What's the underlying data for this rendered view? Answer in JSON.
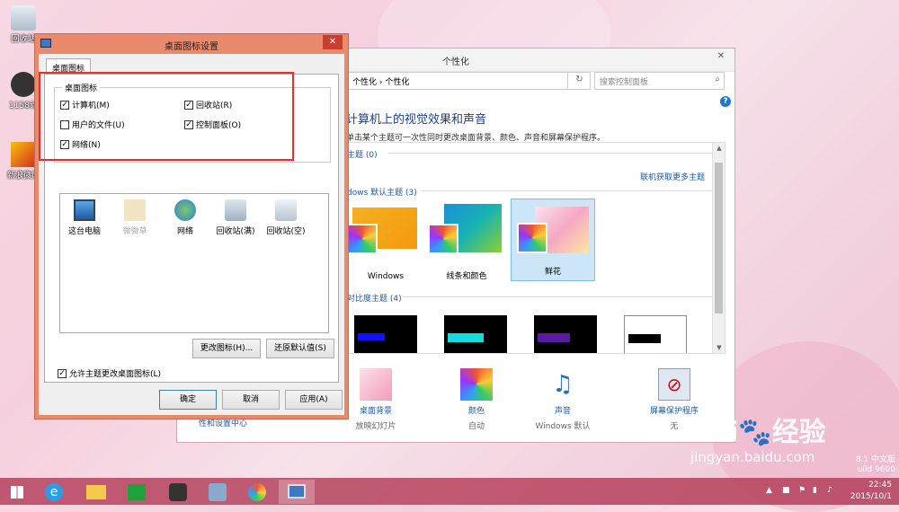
{
  "desktop": {
    "icons": [
      {
        "label": "回收站"
      },
      {
        "label": "1158计"
      },
      {
        "label": "新浪微博"
      }
    ]
  },
  "personalization": {
    "title": "个性化",
    "address_crumbs": "个性化 › 个性化",
    "search_placeholder": "搜索控制面板",
    "heading": "计算机上的视觉效果和声音",
    "subheading": "单击某个主题可一次性同时更改桌面背景、颜色、声音和屏幕保护程序。",
    "my_themes": "主题 (0)",
    "get_more": "联机获取更多主题",
    "default_themes": "dows 默认主题 (3)",
    "themes": [
      {
        "label": "Windows"
      },
      {
        "label": "线条和颜色"
      },
      {
        "label": "鲜花"
      }
    ],
    "high_contrast": "对比度主题 (4)",
    "bottom": [
      {
        "label": "桌面背景",
        "sub": "放映幻灯片"
      },
      {
        "label": "颜色",
        "sub": "自动"
      },
      {
        "label": "声音",
        "sub": "Windows 默认"
      },
      {
        "label": "屏幕保护程序",
        "sub": "无"
      }
    ],
    "partial_bottom_text": "性和设置中心"
  },
  "dialog": {
    "title": "桌面图标设置",
    "tab": "桌面图标",
    "group_label": "桌面图标",
    "checkboxes": {
      "computer": {
        "label": "计算机(M)",
        "checked": true
      },
      "recycle": {
        "label": "回收站(R)",
        "checked": true
      },
      "user_files": {
        "label": "用户的文件(U)",
        "checked": false
      },
      "control_panel": {
        "label": "控制面板(O)",
        "checked": true
      },
      "network": {
        "label": "网络(N)",
        "checked": true
      }
    },
    "icons": [
      {
        "label": "这台电脑"
      },
      {
        "label": "微微草"
      },
      {
        "label": "网络"
      },
      {
        "label": "回收站(满)"
      },
      {
        "label": "回收站(空)"
      }
    ],
    "change_icon": "更改图标(H)...",
    "restore_default": "还原默认值(S)",
    "allow_themes": "允许主题更改桌面图标(L)",
    "ok": "确定",
    "cancel": "取消",
    "apply": "应用(A)"
  },
  "taskbar": {
    "time": "22:45",
    "date": "2015/10/1",
    "build_line1": "8.1 中文版",
    "build_line2": "uild 9600"
  },
  "watermark": {
    "brand": "Bai",
    "brand2": "经验",
    "url": "jingyan.baidu.com"
  },
  "colors": {
    "accent_taskbar": "#af3452",
    "dialog_frame": "#e98a6d",
    "link": "#1e5aa8",
    "highlight": "#e53030"
  }
}
